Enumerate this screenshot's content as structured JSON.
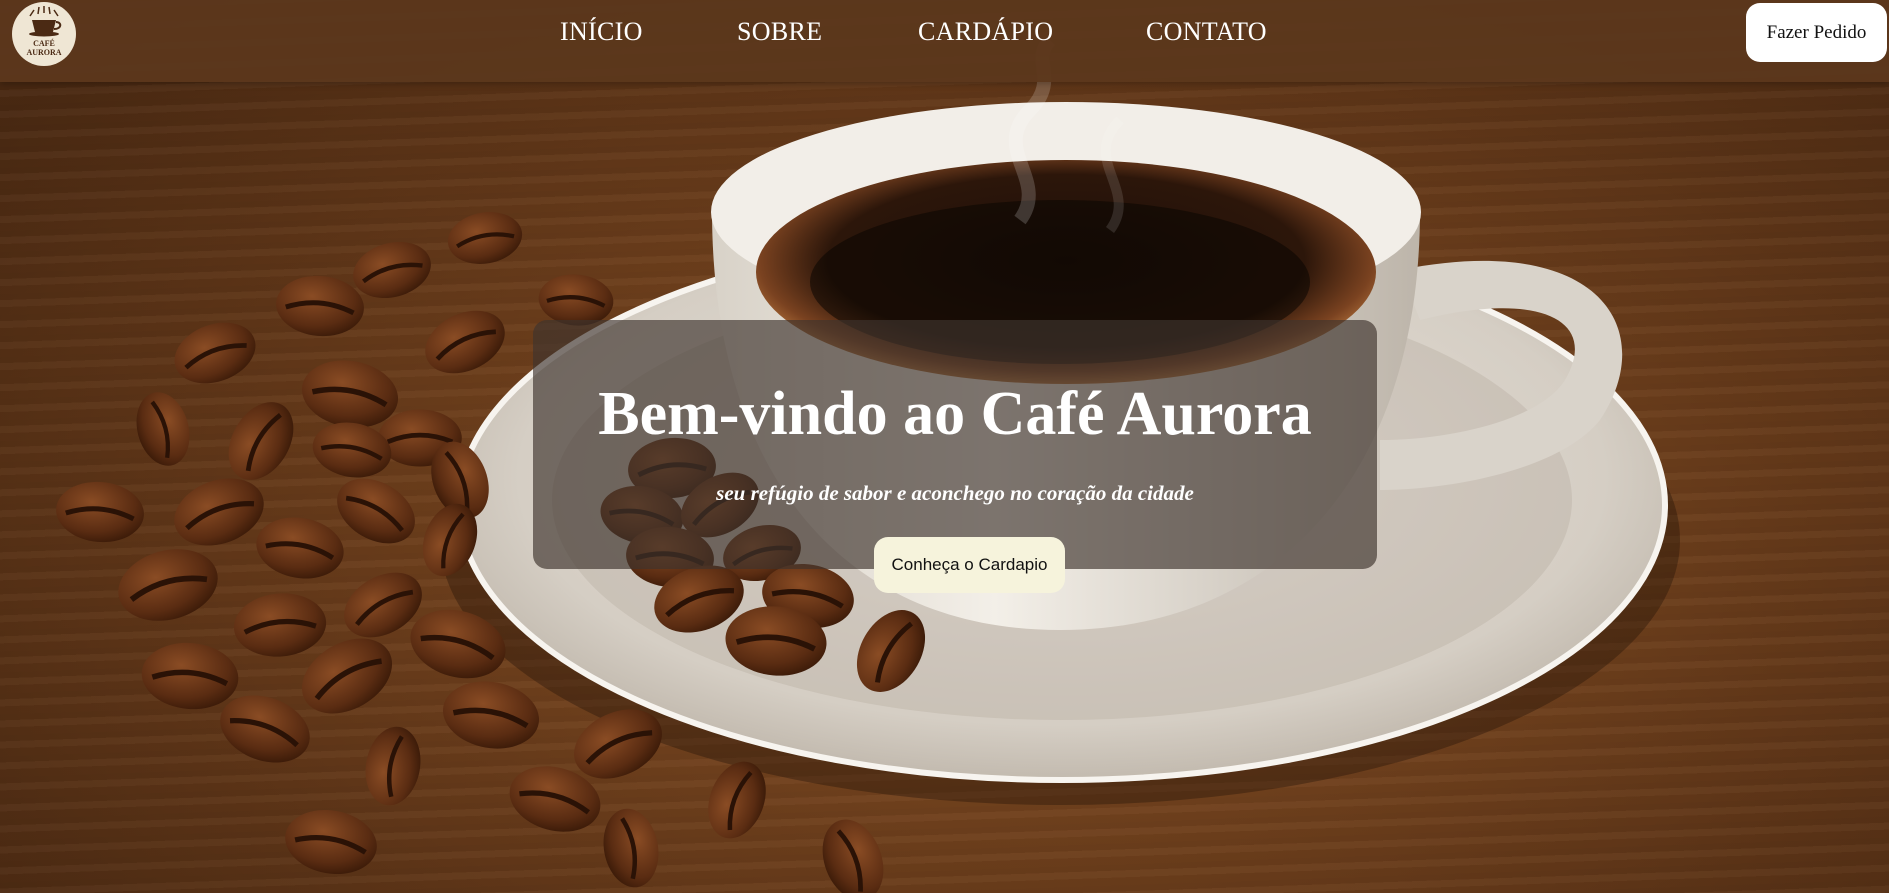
{
  "header": {
    "logo": {
      "line1": "CAFÉ",
      "line2": "AURORA",
      "icon": "coffee-cup-icon"
    },
    "nav": [
      {
        "label": "INÍCIO"
      },
      {
        "label": "SOBRE"
      },
      {
        "label": "CARDÁPIO"
      },
      {
        "label": "CONTATO"
      }
    ],
    "order_button": "Fazer Pedido"
  },
  "hero": {
    "title": "Bem-vindo ao Café Aurora",
    "subtitle": "seu refúgio de sabor e aconchego no coração da cidade",
    "cta": "Conheça o Cardapio",
    "background_image": "coffee-cup-with-beans-photo"
  },
  "colors": {
    "header_bg": "#5c371c",
    "overlay_bg": "#3e342d",
    "cta_bg": "#f6f3dc",
    "text_light": "#ffffff"
  }
}
